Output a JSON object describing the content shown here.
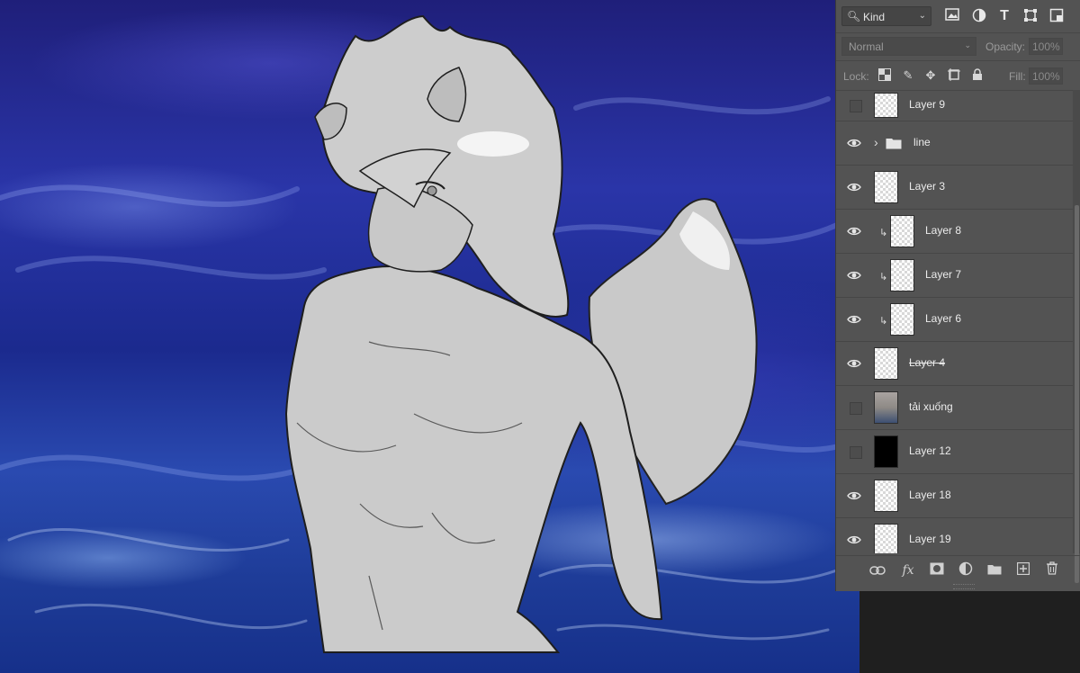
{
  "panel": {
    "filter": {
      "label": "Kind",
      "icon": "search-icon"
    },
    "filter_icons": [
      "image-filter-icon",
      "adjustment-filter-icon",
      "type-filter-icon",
      "shape-filter-icon",
      "smart-object-filter-icon"
    ],
    "blend_mode": "Normal",
    "opacity_label": "Opacity:",
    "opacity_value": "100%",
    "lock_label": "Lock:",
    "fill_label": "Fill:",
    "fill_value": "100%",
    "layers": [
      {
        "name": "Layer 9",
        "visible": false,
        "type": "pixel",
        "clipped": false
      },
      {
        "name": "line",
        "visible": true,
        "type": "group",
        "clipped": false
      },
      {
        "name": "Layer 3",
        "visible": true,
        "type": "pixel",
        "clipped": false
      },
      {
        "name": "Layer 8",
        "visible": true,
        "type": "pixel",
        "clipped": true
      },
      {
        "name": "Layer 7",
        "visible": true,
        "type": "pixel",
        "clipped": true
      },
      {
        "name": "Layer 6",
        "visible": true,
        "type": "pixel",
        "clipped": true
      },
      {
        "name": "Layer 4",
        "visible": true,
        "type": "pixel",
        "clipped": false,
        "strikethrough": true
      },
      {
        "name": "tải xuống",
        "visible": false,
        "type": "photo",
        "clipped": false
      },
      {
        "name": "Layer 12",
        "visible": false,
        "type": "black-fill",
        "clipped": false
      },
      {
        "name": "Layer 18",
        "visible": true,
        "type": "pixel",
        "clipped": false
      },
      {
        "name": "Layer 19",
        "visible": true,
        "type": "pixel",
        "clipped": false
      }
    ],
    "bottom_icons": [
      "link-layers-icon",
      "layer-style-fx-icon",
      "layer-mask-icon",
      "adjustment-layer-icon",
      "new-group-icon",
      "new-layer-icon",
      "delete-layer-icon"
    ]
  },
  "colors": {
    "panel_bg": "#535353",
    "canvas_sky": "#2a35a8",
    "figure_fill": "#cfcfcf"
  }
}
